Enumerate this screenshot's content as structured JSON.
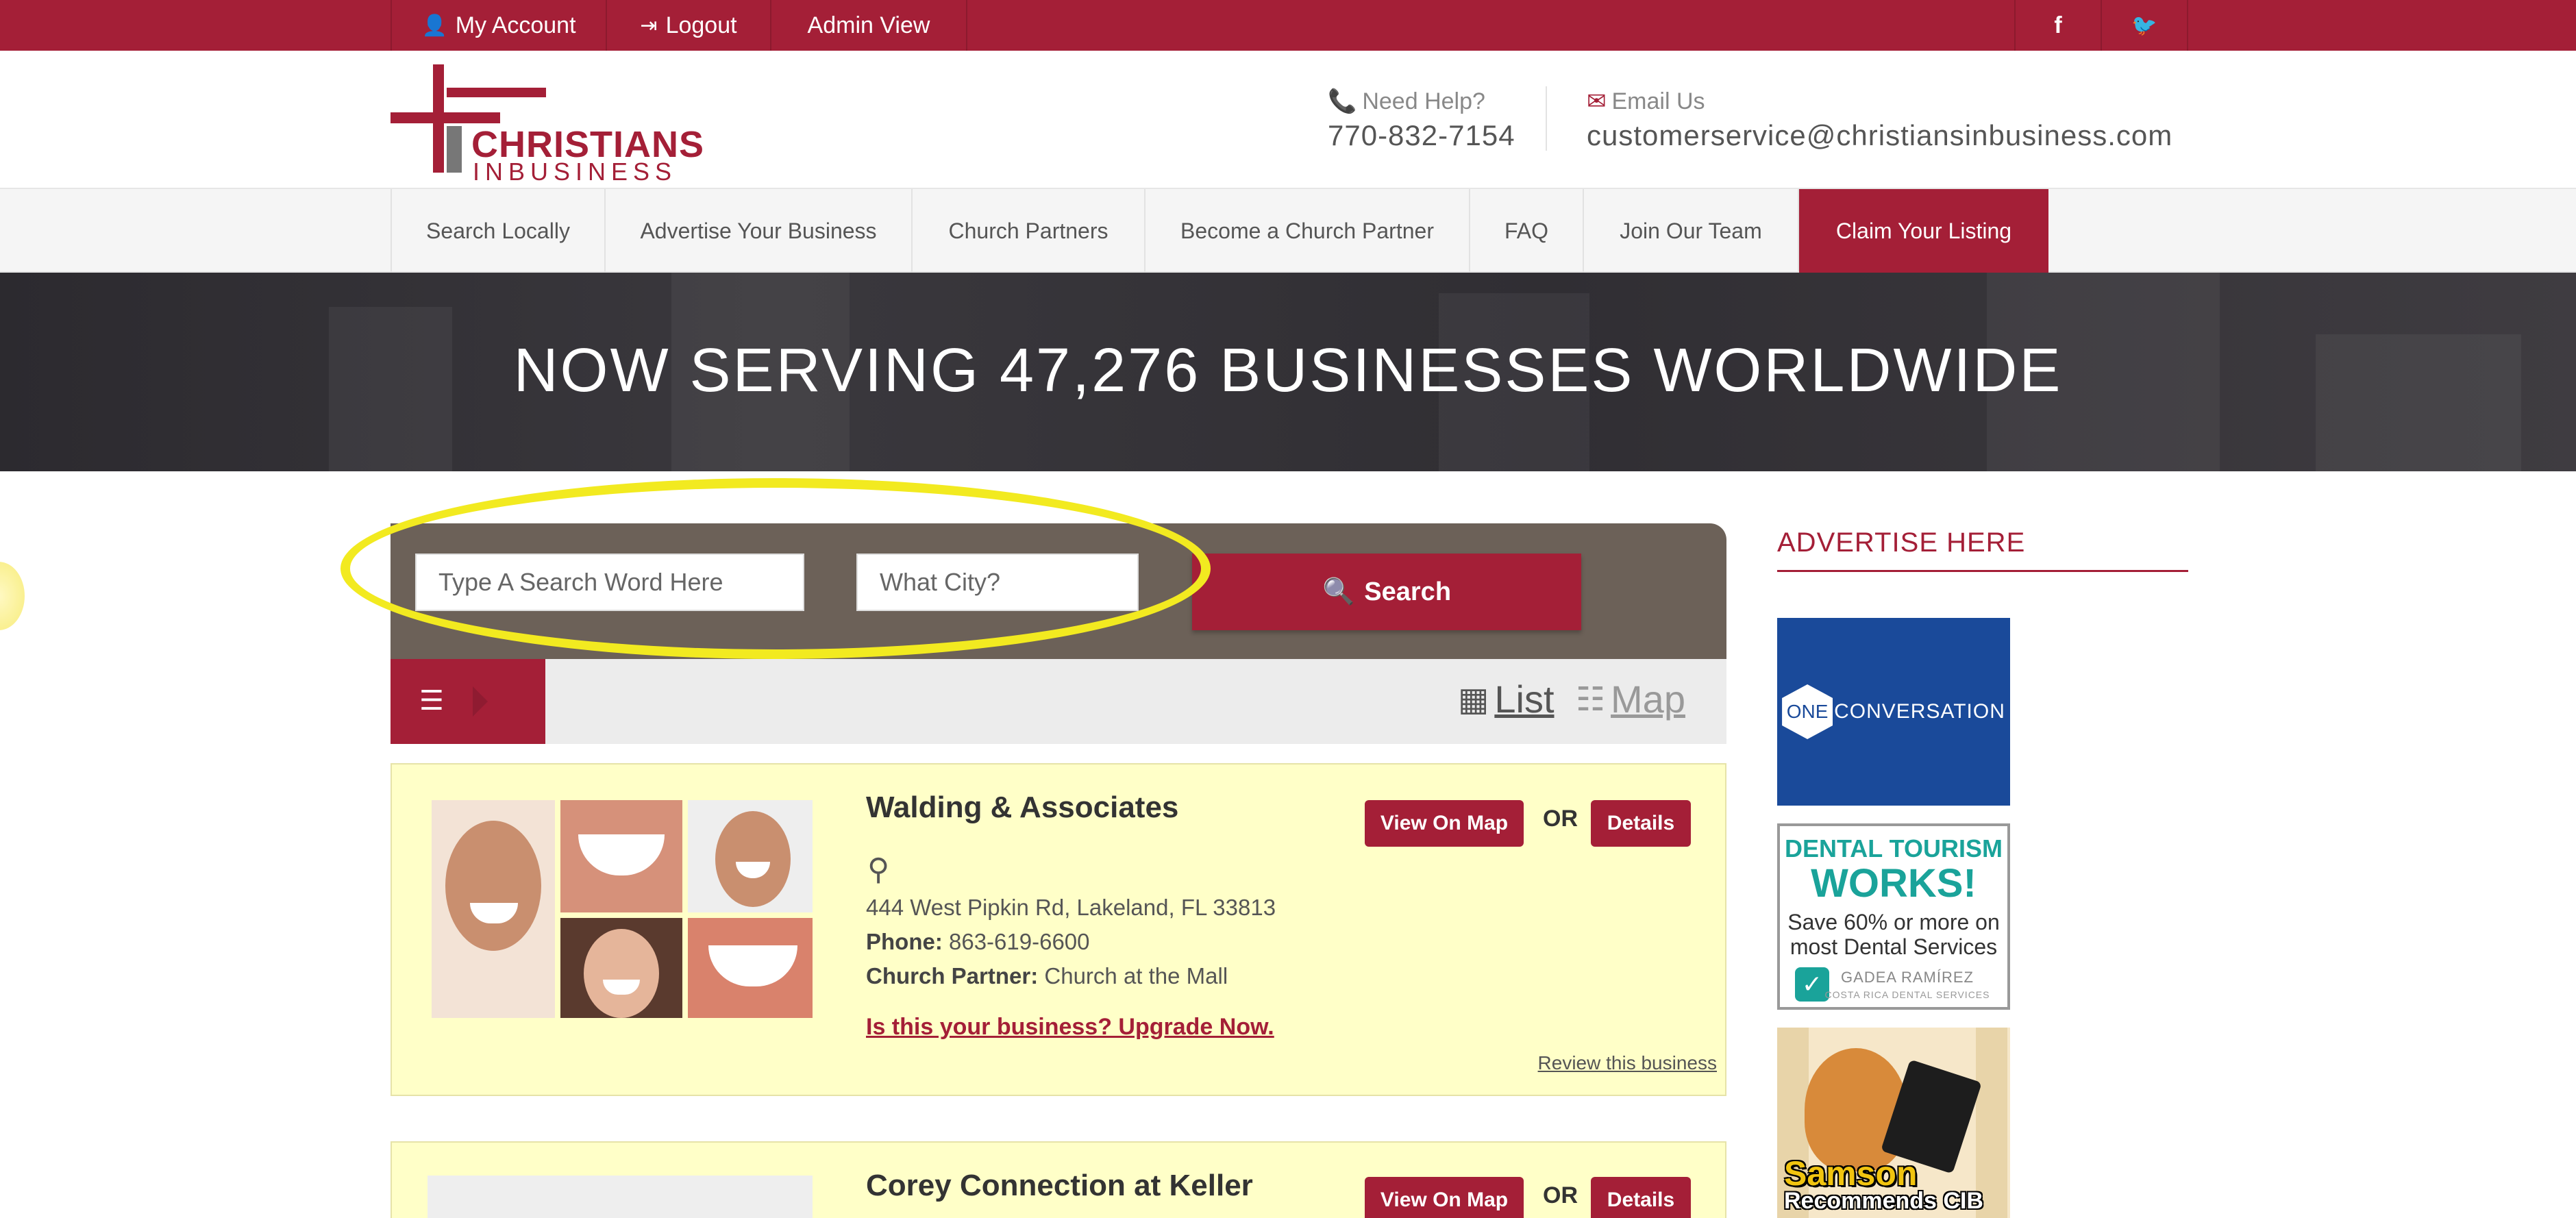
{
  "topbar": {
    "my_account": "My Account",
    "logout": "Logout",
    "admin_view": "Admin View",
    "facebook": "f",
    "twitter": "🐦"
  },
  "header": {
    "logo_line1": "CHRISTIANS",
    "logo_line2": "INBUSINESS",
    "help_label": "Need Help?",
    "help_phone": "770-832-7154",
    "email_label": "Email Us",
    "email_value": "customerservice@christiansinbusiness.com"
  },
  "nav": {
    "items": [
      "Search Locally",
      "Advertise Your Business",
      "Church Partners",
      "Become a Church Partner",
      "FAQ",
      "Join Our Team",
      "Claim Your Listing"
    ]
  },
  "hero": {
    "title": "NOW SERVING 47,276 BUSINESSES WORLDWIDE"
  },
  "search": {
    "keyword_placeholder": "Type A Search Word Here",
    "city_placeholder": "What City?",
    "button_label": "Search"
  },
  "view": {
    "list_label": " List",
    "map_label": " Map"
  },
  "listings": [
    {
      "name": "Walding & Associates",
      "address": "444 West Pipkin Rd, Lakeland, FL 33813",
      "phone_label": "Phone:",
      "phone": "863-619-6600",
      "church_label": "Church Partner:",
      "church": "Church at the Mall",
      "upgrade": "Is this your business? Upgrade Now.",
      "review": "Review this business",
      "view_on_map": "View On Map",
      "or": "OR",
      "details": "Details"
    },
    {
      "name": "Corey Connection at Keller",
      "view_on_map": "View On Map",
      "or": "OR",
      "details": "Details"
    }
  ],
  "sidebar": {
    "advertise_title": "ADVERTISE HERE",
    "ad1_hex": "ONE",
    "ad1_word": "CONVERSATION",
    "ad2_line1": "DENTAL TOURISM",
    "ad2_line2": "WORKS!",
    "ad2_line3": "Save 60% or more on",
    "ad2_line4": "most Dental Services",
    "ad2_line5": "GADEA RAMÍREZ",
    "ad2_line6": "COSTA RICA DENTAL SERVICES",
    "ad3_line1": "Samson",
    "ad3_line2": "Recommends CIB"
  },
  "colors": {
    "brand": "#a41f37",
    "highlight": "#f2ea20",
    "card_bg": "#ffffc8"
  }
}
